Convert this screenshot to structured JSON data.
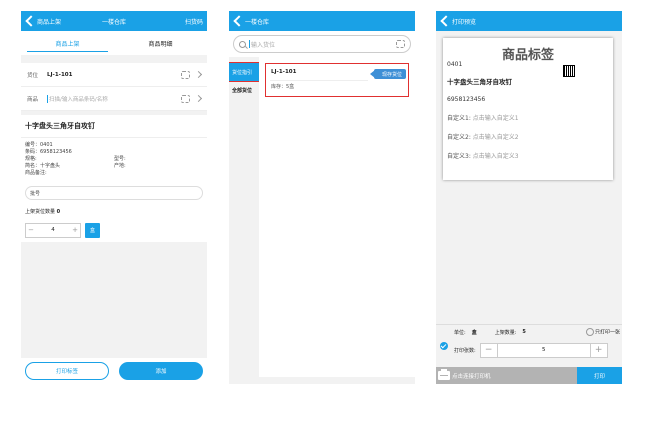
{
  "screen1": {
    "header": {
      "back_label": "商品上架",
      "title": "一楼仓库",
      "right": "扫货码"
    },
    "tabs": [
      "商品上架",
      "商品明细"
    ],
    "location": {
      "label": "货位",
      "value": "LJ-1-101"
    },
    "product_field": {
      "label": "商品",
      "placeholder": "扫描/输入商品条码/名称"
    },
    "product": {
      "name": "十字盘头三角牙自攻钉",
      "number": "编号：0401",
      "barcode": "条码：6958123456",
      "spec": "规格:",
      "model": "型号:",
      "brand": "简名：十字盘头",
      "origin": "产地:",
      "note": "商品备注:"
    },
    "batch_placeholder": "批号",
    "shelf_qty_label": "上架货位数量",
    "shelf_qty_value": "0",
    "quantity": "4",
    "unit": "盒",
    "buttons": {
      "print_label": "打印标签",
      "add": "添加"
    }
  },
  "screen2": {
    "header": {
      "title": "一楼仓库"
    },
    "search_placeholder": "输入货位",
    "sidebar": [
      "货位指引",
      "全部货位"
    ],
    "card": {
      "code": "LJ-1-101",
      "stock": "库存：5盒",
      "tag": "现存货位"
    }
  },
  "screen3": {
    "header": {
      "title": "打印预览"
    },
    "label": {
      "title": "商品标签",
      "code": "0401",
      "name": "十字盘头三角牙自攻钉",
      "barcode": "6958123456",
      "custom1_label": "自定义1:",
      "custom1_hint": "点击输入自定义1",
      "custom2_label": "自定义2:",
      "custom2_hint": "点击输入自定义2",
      "custom3_label": "自定义3:",
      "custom3_hint": "点击输入自定义3"
    },
    "panel": {
      "unit_label": "单位:",
      "unit_value": "盒",
      "qty_label": "上架数量:",
      "qty_value": "5",
      "print_one": "只打印一张",
      "copies_label": "打印张数:",
      "copies_value": "5"
    },
    "bottom": {
      "connect": "点击连接打印机",
      "print": "打印"
    }
  },
  "colors": {
    "accent": "#1aa1e6",
    "highlight": "#e03030",
    "disabled": "#b3b3b3"
  }
}
